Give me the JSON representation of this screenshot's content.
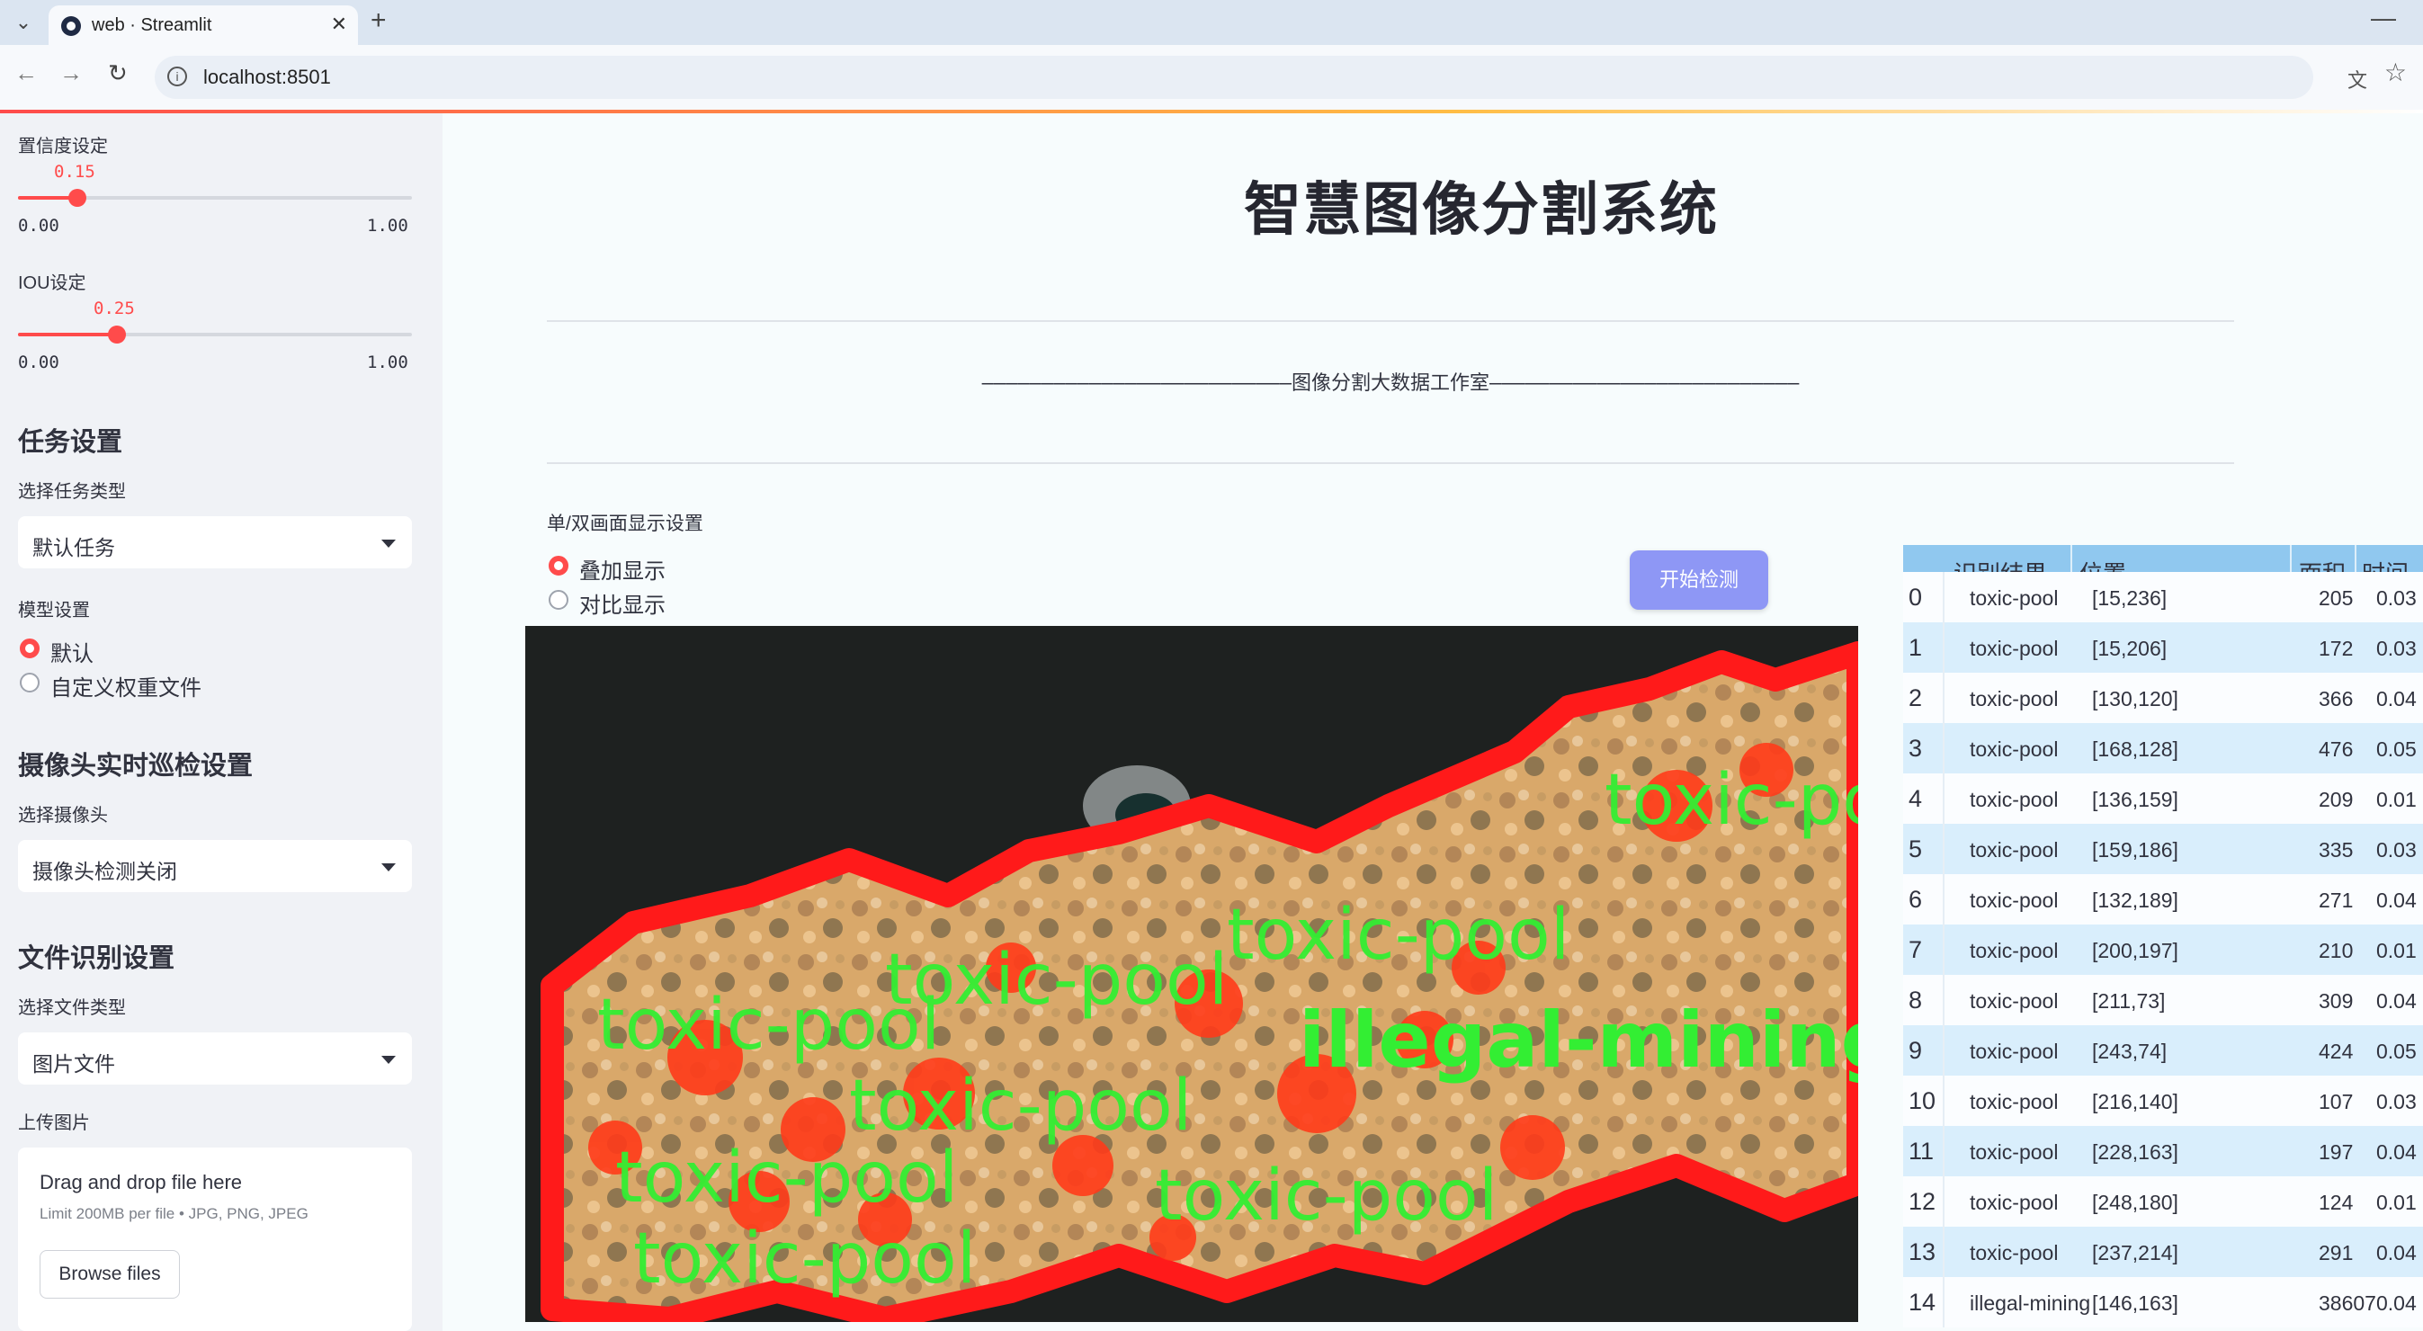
{
  "browser": {
    "tab_title": "web · Streamlit",
    "url": "localhost:8501",
    "new_tab_icon": "plus-icon",
    "close_icon": "close-icon"
  },
  "sidebar": {
    "confidence": {
      "label": "置信度设定",
      "value": "0.15",
      "value_fraction": 0.15,
      "min": "0.00",
      "max": "1.00"
    },
    "iou": {
      "label": "IOU设定",
      "value": "0.25",
      "value_fraction": 0.25,
      "min": "0.00",
      "max": "1.00"
    },
    "task_heading": "任务设置",
    "task_type_label": "选择任务类型",
    "task_type_value": "默认任务",
    "model_label": "模型设置",
    "model_options": [
      "默认",
      "自定义权重文件"
    ],
    "model_selected": 0,
    "camera_heading": "摄像头实时巡检设置",
    "camera_label": "选择摄像头",
    "camera_value": "摄像头检测关闭",
    "file_heading": "文件识别设置",
    "file_type_label": "选择文件类型",
    "file_type_value": "图片文件",
    "upload_label": "上传图片",
    "upload_title": "Drag and drop file here",
    "upload_limit": "Limit 200MB per file • JPG, PNG, JPEG",
    "browse_label": "Browse files"
  },
  "main": {
    "title": "智慧图像分割系统",
    "banner": "——————————————————————————图像分割大数据工作室——————————————————————————",
    "display_mode_label": "单/双画面显示设置",
    "display_options": [
      "叠加显示",
      "对比显示"
    ],
    "display_selected": 0,
    "start_button": "开始检测",
    "overlay_labels": [
      "toxic-pool",
      "illegal-mining"
    ]
  },
  "results_table": {
    "columns": [
      "识别结果",
      "位置",
      "面积",
      "时间"
    ],
    "rows": [
      {
        "idx": "0",
        "label": "toxic-pool",
        "pos": "[15,236]",
        "area": "205",
        "time": "0.03"
      },
      {
        "idx": "1",
        "label": "toxic-pool",
        "pos": "[15,206]",
        "area": "172",
        "time": "0.03"
      },
      {
        "idx": "2",
        "label": "toxic-pool",
        "pos": "[130,120]",
        "area": "366",
        "time": "0.04"
      },
      {
        "idx": "3",
        "label": "toxic-pool",
        "pos": "[168,128]",
        "area": "476",
        "time": "0.05"
      },
      {
        "idx": "4",
        "label": "toxic-pool",
        "pos": "[136,159]",
        "area": "209",
        "time": "0.01"
      },
      {
        "idx": "5",
        "label": "toxic-pool",
        "pos": "[159,186]",
        "area": "335",
        "time": "0.03"
      },
      {
        "idx": "6",
        "label": "toxic-pool",
        "pos": "[132,189]",
        "area": "271",
        "time": "0.04"
      },
      {
        "idx": "7",
        "label": "toxic-pool",
        "pos": "[200,197]",
        "area": "210",
        "time": "0.01"
      },
      {
        "idx": "8",
        "label": "toxic-pool",
        "pos": "[211,73]",
        "area": "309",
        "time": "0.04"
      },
      {
        "idx": "9",
        "label": "toxic-pool",
        "pos": "[243,74]",
        "area": "424",
        "time": "0.05"
      },
      {
        "idx": "10",
        "label": "toxic-pool",
        "pos": "[216,140]",
        "area": "107",
        "time": "0.03"
      },
      {
        "idx": "11",
        "label": "toxic-pool",
        "pos": "[228,163]",
        "area": "197",
        "time": "0.04"
      },
      {
        "idx": "12",
        "label": "toxic-pool",
        "pos": "[248,180]",
        "area": "124",
        "time": "0.01"
      },
      {
        "idx": "13",
        "label": "toxic-pool",
        "pos": "[237,214]",
        "area": "291",
        "time": "0.04"
      },
      {
        "idx": "14",
        "label": "illegal-mining",
        "pos": "[146,163]",
        "area": "38607",
        "time": "0.04"
      }
    ]
  },
  "colors": {
    "accent": "#ff4b4b",
    "sidebar_bg": "#f0f2f6",
    "button": "#8e97f5",
    "table_header": "#90c8ef",
    "table_alt_row": "#d9eefc",
    "mask_outline": "#ff1a1a",
    "label_text": "#33ee33"
  }
}
